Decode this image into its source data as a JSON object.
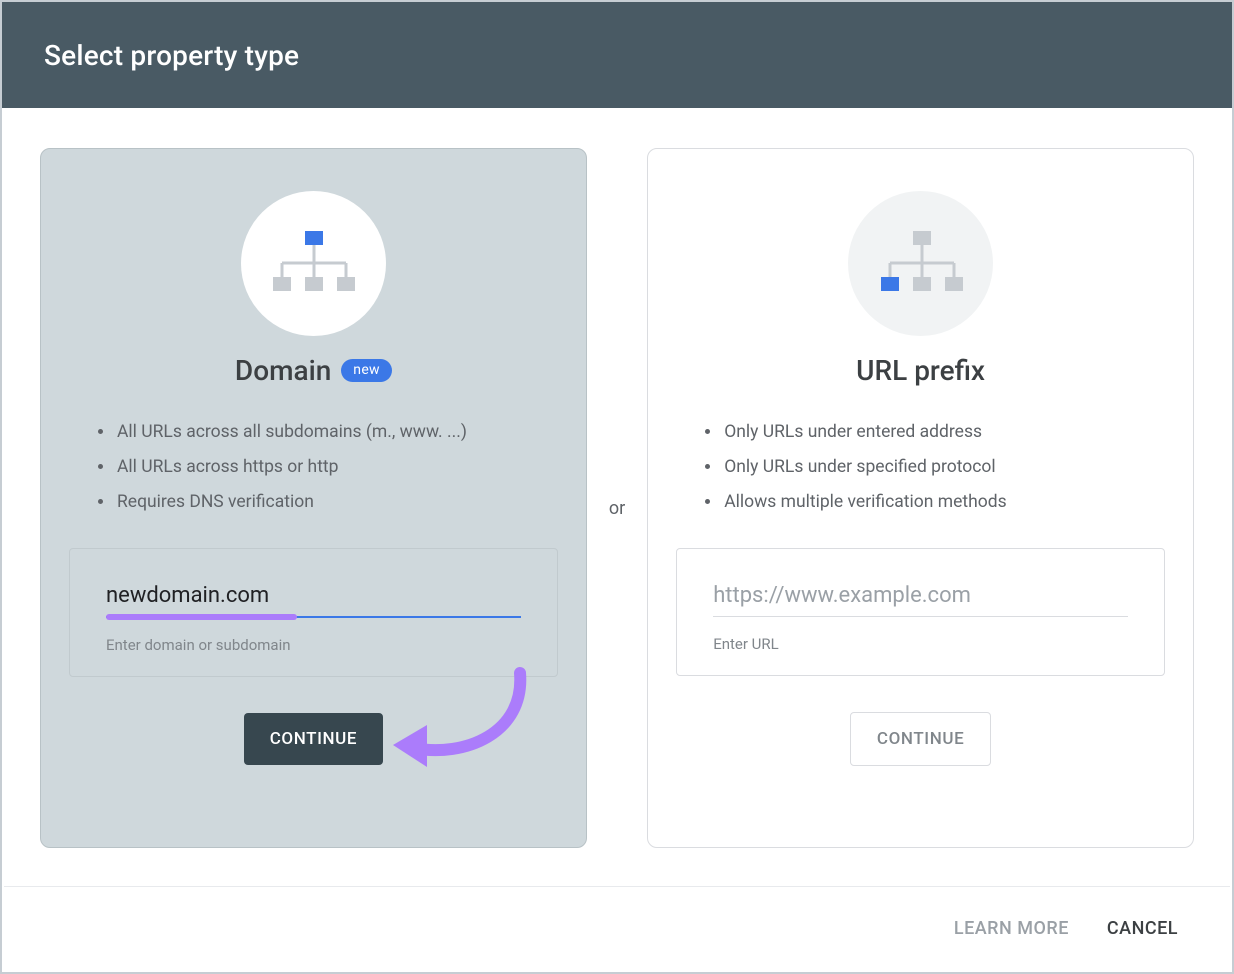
{
  "header": {
    "title": "Select property type"
  },
  "separator": "or",
  "domain_card": {
    "title": "Domain",
    "badge": "new",
    "features": [
      "All URLs across all subdomains (m., www. ...)",
      "All URLs across https or http",
      "Requires DNS verification"
    ],
    "input_value": "newdomain.com",
    "input_helper": "Enter domain or subdomain",
    "continue_label": "CONTINUE"
  },
  "url_card": {
    "title": "URL prefix",
    "features": [
      "Only URLs under entered address",
      "Only URLs under specified protocol",
      "Allows multiple verification methods"
    ],
    "input_placeholder": "https://www.example.com",
    "input_helper": "Enter URL",
    "continue_label": "CONTINUE"
  },
  "footer": {
    "learn_more": "LEARN MORE",
    "cancel": "CANCEL"
  },
  "annotation": {
    "arrow_color": "#ab7cfb",
    "highlight_color": "#ab7cfb"
  }
}
